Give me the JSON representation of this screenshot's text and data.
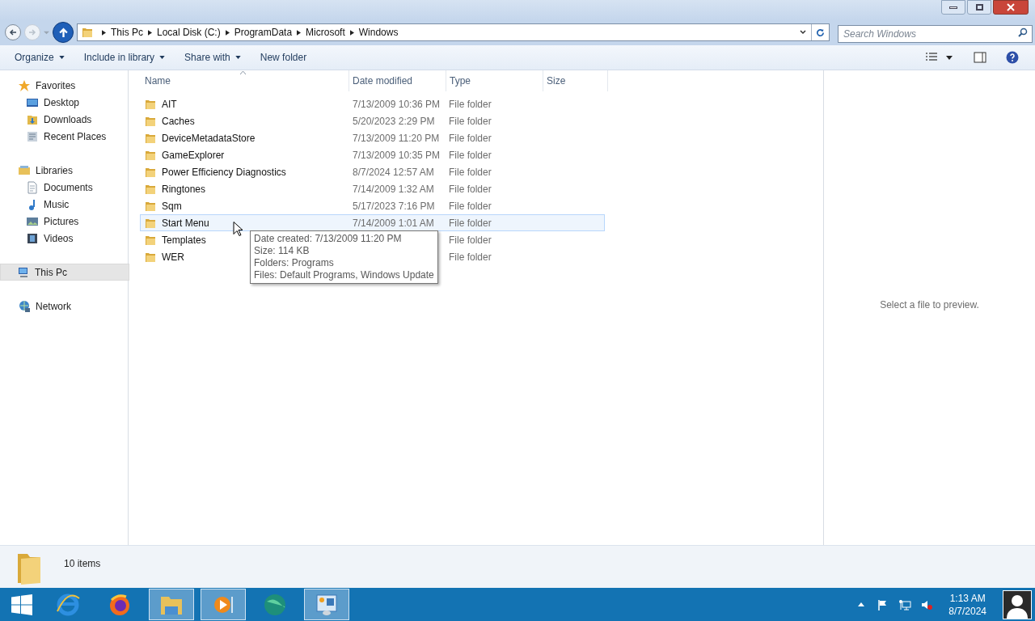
{
  "address": {
    "crumbs": [
      "This Pc",
      "Local Disk (C:)",
      "ProgramData",
      "Microsoft",
      "Windows"
    ]
  },
  "search": {
    "placeholder": "Search Windows"
  },
  "toolbar": {
    "items": [
      {
        "label": "Organize",
        "dropdown": true
      },
      {
        "label": "Include in library",
        "dropdown": true
      },
      {
        "label": "Share with",
        "dropdown": true
      },
      {
        "label": "New folder",
        "dropdown": false
      }
    ]
  },
  "navigation": [
    {
      "label": "Favorites",
      "kind": "star",
      "selected": false,
      "children": [
        {
          "label": "Desktop",
          "kind": "desktop",
          "selected": false
        },
        {
          "label": "Downloads",
          "kind": "downloads",
          "selected": false
        },
        {
          "label": "Recent Places",
          "kind": "recent",
          "selected": false
        }
      ]
    },
    {
      "label": "Libraries",
      "kind": "library",
      "selected": false,
      "children": [
        {
          "label": "Documents",
          "kind": "documents",
          "selected": false
        },
        {
          "label": "Music",
          "kind": "music",
          "selected": false
        },
        {
          "label": "Pictures",
          "kind": "pictures",
          "selected": false
        },
        {
          "label": "Videos",
          "kind": "videos",
          "selected": false
        }
      ]
    },
    {
      "label": "This Pc",
      "kind": "computer",
      "selected": true
    },
    {
      "label": "Network",
      "kind": "network",
      "selected": false
    }
  ],
  "table": {
    "columns": [
      "Name",
      "Date modified",
      "Type",
      "Size"
    ],
    "rows": [
      {
        "name": "AIT",
        "date": "7/13/2009 10:36 PM",
        "type": "File folder",
        "selected": false
      },
      {
        "name": "Caches",
        "date": "5/20/2023 2:29 PM",
        "type": "File folder",
        "selected": false
      },
      {
        "name": "DeviceMetadataStore",
        "date": "7/13/2009 11:20 PM",
        "type": "File folder",
        "selected": false
      },
      {
        "name": "GameExplorer",
        "date": "7/13/2009 10:35 PM",
        "type": "File folder",
        "selected": false
      },
      {
        "name": "Power Efficiency Diagnostics",
        "date": "8/7/2024 12:57 AM",
        "type": "File folder",
        "selected": false
      },
      {
        "name": "Ringtones",
        "date": "7/14/2009 1:32 AM",
        "type": "File folder",
        "selected": false
      },
      {
        "name": "Sqm",
        "date": "5/17/2023 7:16 PM",
        "type": "File folder",
        "selected": false
      },
      {
        "name": "Start Menu",
        "date": "7/14/2009 1:01 AM",
        "type": "File folder",
        "selected": true
      },
      {
        "name": "Templates",
        "type": "File folder",
        "selected": false
      },
      {
        "name": "WER",
        "type": "File folder",
        "selected": false
      }
    ]
  },
  "tooltip": {
    "lines": [
      "Date created: 7/13/2009 11:20 PM",
      "Size: 114 KB",
      "Folders: Programs",
      "Files: Default Programs, Windows Update"
    ]
  },
  "preview": {
    "message": "Select a file to preview."
  },
  "details": {
    "count": "10 items"
  },
  "taskbar": {
    "apps": [
      {
        "kind": "browser-e",
        "active": false
      },
      {
        "kind": "firefox",
        "active": false
      },
      {
        "kind": "explorer",
        "active": true
      },
      {
        "kind": "media",
        "active": true
      },
      {
        "kind": "globe",
        "active": false
      },
      {
        "kind": "panel",
        "active": true
      }
    ],
    "time": "1:13 AM",
    "date": "8/7/2024"
  }
}
